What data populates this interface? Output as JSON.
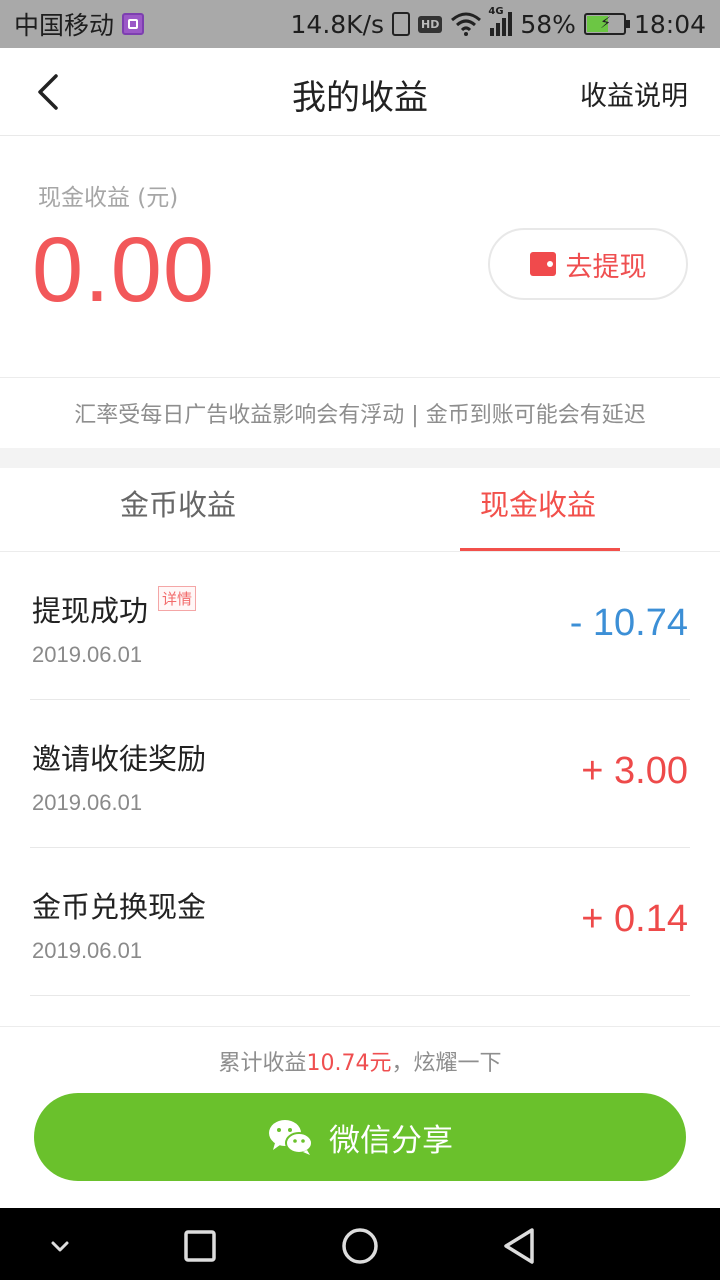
{
  "status_bar": {
    "carrier": "中国移动",
    "net_speed": "14.8K/s",
    "hd_badge": "HD",
    "signal_tag": "4G",
    "battery": "58%",
    "time": "18:04"
  },
  "header": {
    "title": "我的收益",
    "explain_label": "收益说明"
  },
  "summary": {
    "label": "现金收益 (元)",
    "amount": "0.00",
    "withdraw_label": "去提现"
  },
  "notice": "汇率受每日广告收益影响会有浮动 | 金币到账可能会有延迟",
  "tabs": {
    "coin": "金币收益",
    "cash": "现金收益",
    "active": "cash"
  },
  "records": [
    {
      "name": "提现成功",
      "badge": "详情",
      "date": "2019.06.01",
      "amount": "- 10.74",
      "sign": "negative"
    },
    {
      "name": "邀请收徒奖励",
      "date": "2019.06.01",
      "amount": "+ 3.00",
      "sign": "positive"
    },
    {
      "name": "金币兑换现金",
      "date": "2019.06.01",
      "amount": "+ 0.14",
      "sign": "positive"
    }
  ],
  "bottom": {
    "total_prefix": "累计收益",
    "total_amount": "10.74元",
    "total_suffix": "，炫耀一下",
    "share_label": "微信分享"
  },
  "colors": {
    "accent_red": "#f2585a",
    "negative_blue": "#3c8fd6",
    "share_green": "#6ac12c"
  }
}
